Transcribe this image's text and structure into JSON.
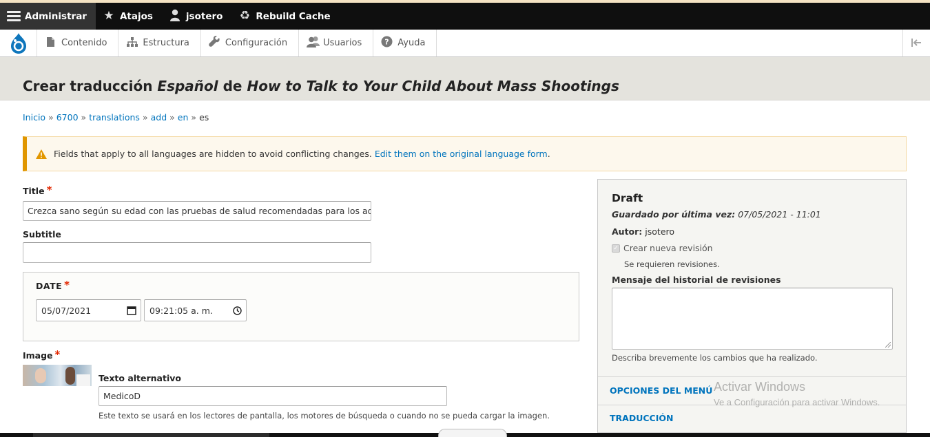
{
  "toolbar": {
    "admin_label": "Administrar",
    "shortcuts_label": "Atajos",
    "user_label": "jsotero",
    "rebuild_label": "Rebuild Cache"
  },
  "tray": {
    "items": [
      {
        "label": "Contenido",
        "icon": "page-icon"
      },
      {
        "label": "Estructura",
        "icon": "sitemap-icon"
      },
      {
        "label": "Configuración",
        "icon": "wrench-icon"
      },
      {
        "label": "Usuarios",
        "icon": "users-icon"
      },
      {
        "label": "Ayuda",
        "icon": "help-icon"
      }
    ]
  },
  "page": {
    "title_prefix": "Crear traducción",
    "title_lang": "Español",
    "title_de": "de",
    "title_node": "How to Talk to Your Child About Mass Shootings"
  },
  "breadcrumb": [
    "Inicio",
    "6700",
    "translations",
    "add",
    "en",
    "es"
  ],
  "breadcrumb_sep": "»",
  "warning": {
    "text": "Fields that apply to all languages are hidden to avoid conflicting changes.",
    "link": "Edit them on the original language form",
    "tail": "."
  },
  "form": {
    "title_label": "Title",
    "title_value": "Crezca sano según su edad con las pruebas de salud recomendadas para los adultos",
    "subtitle_label": "Subtitle",
    "subtitle_value": "",
    "date_label": "DATE",
    "date_value": "05/07/2021",
    "time_value": "09:21:05 a. m.",
    "image_label": "Image",
    "alt_label": "Texto alternativo",
    "alt_value": "MedicoD",
    "alt_help": "Este texto se usará en los lectores de pantalla, los motores de búsqueda o cuando no se pueda cargar la imagen.",
    "required_mark": "*"
  },
  "sidebar": {
    "status": "Draft",
    "saved_label": "Guardado por última vez:",
    "saved_value": "07/05/2021 - 11:01",
    "author_label": "Autor:",
    "author_value": "jsotero",
    "new_revision_label": "Crear nueva revisión",
    "revision_required": "Se requieren revisiones.",
    "log_label": "Mensaje del historial de revisiones",
    "log_help": "Describa brevemente los cambios que ha realizado.",
    "menu_options": "OPCIONES DEL MENÚ",
    "translation": "TRADUCCIÓN"
  },
  "watermark": {
    "line1": "Activar Windows",
    "line2": "Ve a Configuración para activar Windows."
  },
  "colors": {
    "link": "#0074bd",
    "warning_border": "#e09600",
    "required": "#e32700",
    "toolbar_bg": "#0f0f0f"
  }
}
